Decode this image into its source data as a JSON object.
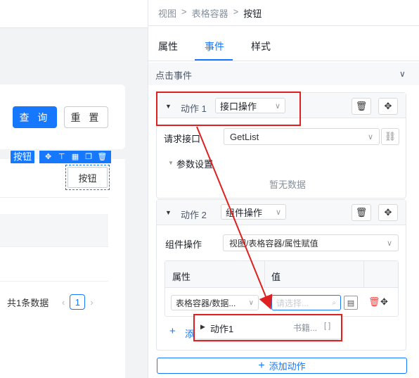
{
  "canvas": {
    "query_button": "查 询",
    "reset_button": "重 置",
    "selected_label": "按钮",
    "selected_button": "按钮",
    "total_text": "共1条数据",
    "page_number": "1",
    "prev_arrow": "‹",
    "next_arrow": "›"
  },
  "panel": {
    "breadcrumb": [
      "视图",
      ">",
      "表格容器",
      ">",
      "按钮"
    ],
    "tabs": [
      {
        "label": "属性",
        "active": false
      },
      {
        "label": "事件",
        "active": true
      },
      {
        "label": "样式",
        "active": false
      }
    ],
    "section_title": "点击事件",
    "section_chevron": "∨",
    "actions": [
      {
        "label": "动作 1",
        "type_value": "接口操作",
        "fields": {
          "api_label": "请求接口",
          "api_value": "GetList",
          "params_label": "参数设置",
          "empty_text": "暂无数据"
        }
      },
      {
        "label": "动作 2",
        "type_value": "组件操作",
        "fields": {
          "component_op_label": "组件操作",
          "component_op_value": "视图/表格容器/属性赋值",
          "table_headers": [
            "属性",
            "值"
          ],
          "row_property": "表格容器/数据...",
          "row_value_placeholder": "请选择...",
          "add_link": "添"
        }
      }
    ],
    "popup": {
      "label": "动作1",
      "value": "书籍...",
      "bracket": "[ ]"
    },
    "add_action_button": "添加动作"
  },
  "colors": {
    "accent": "#1677ff",
    "highlight_red": "#e02020",
    "delete_red": "#f53f3f"
  }
}
